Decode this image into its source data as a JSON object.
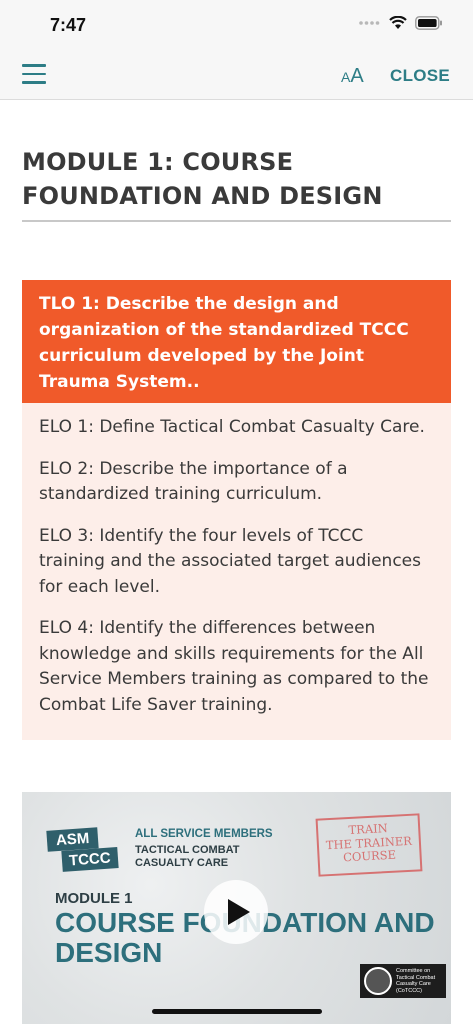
{
  "status_bar": {
    "time": "7:47"
  },
  "nav": {
    "font_size_small": "A",
    "font_size_large": "A",
    "close_label": "CLOSE"
  },
  "module": {
    "title": "MODULE 1: COURSE FOUNDATION AND DESIGN"
  },
  "tlo": {
    "text": "TLO 1: Describe the design and organization of the standardized TCCC curriculum developed by the Joint Trauma System.."
  },
  "elos": [
    "ELO 1: Define Tactical Combat Casualty Care.",
    "ELO 2: Describe the importance of a standardized training curriculum.",
    "ELO 3: Identify the four levels of TCCC training and the associated target audiences for each level.",
    "ELO 4: Identify the differences between knowledge and skills requirements for the All Service Members training as compared to the Combat Life Saver training."
  ],
  "video": {
    "badge_asm": "ASM",
    "badge_tccc": "TCCC",
    "audience_line1": "ALL SERVICE MEMBERS",
    "audience_line2": "TACTICAL COMBAT CASUALTY CARE",
    "stamp_line1": "TRAIN",
    "stamp_line2": "THE TRAINER",
    "stamp_line3": "COURSE",
    "module_label": "MODULE 1",
    "course_title": "COURSE FOUNDATION AND DESIGN",
    "logo_text": "Committee on Tactical Combat Casualty Care (CoTCCC)"
  },
  "colors": {
    "accent": "#2d7d86",
    "tlo_background": "#f05a2a",
    "elo_background": "#fdeee9"
  }
}
